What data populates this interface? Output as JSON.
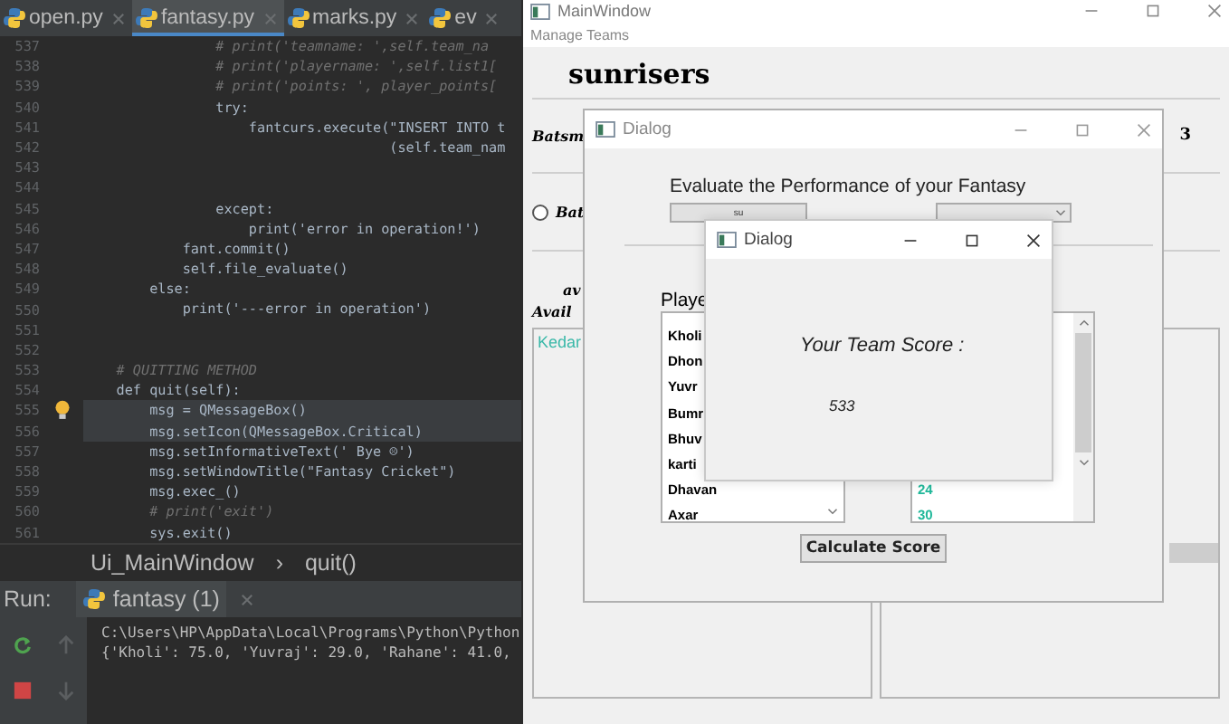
{
  "editor": {
    "tabs": [
      {
        "label": "open.py",
        "selected": false
      },
      {
        "label": "fantasy.py",
        "selected": true
      },
      {
        "label": "marks.py",
        "selected": false
      },
      {
        "label": "ev",
        "selected": false
      }
    ],
    "lines": [
      {
        "number": "537",
        "kind": "comment",
        "text": "                # print('teamname: ',self.team_na",
        "highlighted": false,
        "bulb": false
      },
      {
        "number": "538",
        "kind": "comment",
        "text": "                # print('playername: ',self.list1[",
        "highlighted": false,
        "bulb": false
      },
      {
        "number": "539",
        "kind": "comment",
        "text": "                # print('points: ', player_points[",
        "highlighted": false,
        "bulb": false
      },
      {
        "number": "540",
        "kind": "code",
        "text": "                try:",
        "highlighted": false,
        "bulb": false
      },
      {
        "number": "541",
        "kind": "code",
        "text": "                    fantcurs.execute(\"INSERT INTO t",
        "highlighted": false,
        "bulb": false
      },
      {
        "number": "542",
        "kind": "code",
        "text": "                                     (self.team_nam",
        "highlighted": false,
        "bulb": false
      },
      {
        "number": "543",
        "kind": "blank",
        "highlighted": false,
        "bulb": false
      },
      {
        "number": "544",
        "kind": "blank",
        "highlighted": false,
        "bulb": false
      },
      {
        "number": "545",
        "kind": "code",
        "text": "                except:",
        "highlighted": false,
        "bulb": false
      },
      {
        "number": "546",
        "kind": "code",
        "text": "                    print('error in operation!')",
        "highlighted": false,
        "bulb": false
      },
      {
        "number": "547",
        "kind": "code",
        "text": "            fant.commit()",
        "highlighted": false,
        "bulb": false
      },
      {
        "number": "548",
        "kind": "code",
        "text": "            self.file_evaluate()",
        "highlighted": false,
        "bulb": false
      },
      {
        "number": "549",
        "kind": "code",
        "text": "        else:",
        "highlighted": false,
        "bulb": false
      },
      {
        "number": "550",
        "kind": "code",
        "text": "            print('---error in operation')",
        "highlighted": false,
        "bulb": false
      },
      {
        "number": "551",
        "kind": "blank",
        "highlighted": false,
        "bulb": false
      },
      {
        "number": "552",
        "kind": "blank",
        "highlighted": false,
        "bulb": false
      },
      {
        "number": "553",
        "kind": "comment",
        "text": "    # QUITTING METHOD",
        "highlighted": false,
        "bulb": false
      },
      {
        "number": "554",
        "kind": "code",
        "text": "    def quit(self):",
        "highlighted": false,
        "bulb": false
      },
      {
        "number": "555",
        "kind": "code",
        "text": "        msg = QMessageBox()",
        "highlighted": true,
        "bulb": true
      },
      {
        "number": "556",
        "kind": "code",
        "text": "        msg.setIcon(QMessageBox.Critical)",
        "highlighted": true,
        "bulb": false
      },
      {
        "number": "557",
        "kind": "code",
        "text": "        msg.setInformativeText(' Bye ☹')",
        "highlighted": false,
        "bulb": false
      },
      {
        "number": "558",
        "kind": "code",
        "text": "        msg.setWindowTitle(\"Fantasy Cricket\")",
        "highlighted": false,
        "bulb": false
      },
      {
        "number": "559",
        "kind": "code",
        "text": "        msg.exec_()",
        "highlighted": false,
        "bulb": false
      },
      {
        "number": "560",
        "kind": "comment",
        "text": "        # print('exit')",
        "highlighted": false,
        "bulb": false
      },
      {
        "number": "561",
        "kind": "code",
        "text": "        sys.exit()",
        "highlighted": false,
        "bulb": false
      }
    ],
    "breadcrumb": [
      "Ui_MainWindow",
      "›",
      "quit()"
    ],
    "run": {
      "label": "Run:",
      "tab": "fantasy (1)",
      "output": [
        "C:\\Users\\HP\\AppData\\Local\\Programs\\Python\\Python",
        "{'Kholi': 75.0, 'Yuvraj': 29.0, 'Rahane': 41.0,"
      ]
    }
  },
  "main_window": {
    "title": "MainWindow",
    "menu": [
      "Manage Teams"
    ],
    "team_name": "sunrisers",
    "row_label": "Batsm",
    "row_value": "3",
    "radio": {
      "label": "Bat",
      "checked": false
    },
    "labels": [
      "av",
      "Avail"
    ],
    "available": [
      "Kedar"
    ]
  },
  "dialog": {
    "title": "Dialog",
    "heading": "Evaluate the Performance of your Fantasy",
    "team_button": "su",
    "players_label": "Playe",
    "players": [
      "Kholi",
      "Dhon",
      "Yuvr",
      "Bumr",
      "Bhuv",
      "karti",
      "Dhavan",
      "Axar"
    ],
    "points": [
      "24",
      "30"
    ],
    "button": "Calculate Score"
  },
  "score_dialog": {
    "title": "Dialog",
    "label": "Your Team Score :",
    "score": "533"
  }
}
